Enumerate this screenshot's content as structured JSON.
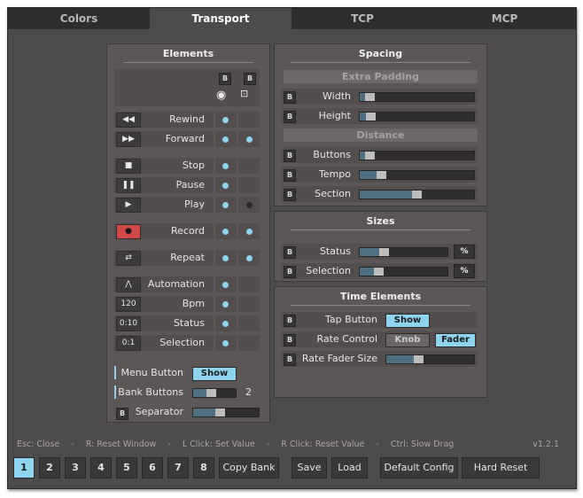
{
  "tabs": [
    {
      "label": "Colors"
    },
    {
      "label": "Transport"
    },
    {
      "label": "TCP"
    },
    {
      "label": "MCP"
    }
  ],
  "elements_panel": {
    "title": "Elements",
    "b_label": "B",
    "items": [
      {
        "icon": "rewind-icon",
        "label": "Rewind",
        "glyph": "◀◀"
      },
      {
        "icon": "forward-icon",
        "label": "Forward",
        "glyph": "▶▶"
      },
      {
        "icon": "stop-icon",
        "label": "Stop",
        "glyph": "■"
      },
      {
        "icon": "pause-icon",
        "label": "Pause",
        "glyph": "❚❚"
      },
      {
        "icon": "play-icon",
        "label": "Play",
        "glyph": "▶"
      },
      {
        "icon": "record-icon",
        "label": "Record",
        "glyph": "●"
      },
      {
        "icon": "repeat-icon",
        "label": "Repeat",
        "glyph": "⇄"
      },
      {
        "icon": "automation-icon",
        "label": "Automation",
        "glyph": "⋀"
      },
      {
        "icon": "bpm-icon",
        "label": "Bpm",
        "glyph": "120"
      },
      {
        "icon": "status-icon",
        "label": "Status",
        "glyph": "0:10"
      },
      {
        "icon": "selection-icon",
        "label": "Selection",
        "glyph": "0:1"
      }
    ],
    "menu_button": {
      "label": "Menu Button",
      "value": "Show"
    },
    "bank_buttons": {
      "label": "Bank Buttons",
      "value": "2",
      "level": 0.4
    },
    "separator": {
      "label": "Separator",
      "level": 0.4
    }
  },
  "spacing_panel": {
    "title": "Spacing",
    "extra_padding": "Extra Padding",
    "distance": "Distance",
    "rows": [
      {
        "label": "Width",
        "level": 0.05
      },
      {
        "label": "Height",
        "level": 0.06
      },
      {
        "label": "Buttons",
        "level": 0.05
      },
      {
        "label": "Tempo",
        "level": 0.16
      },
      {
        "label": "Section",
        "level": 0.5
      }
    ]
  },
  "sizes_panel": {
    "title": "Sizes",
    "pct_label": "%",
    "rows": [
      {
        "label": "Status",
        "level": 0.25
      },
      {
        "label": "Selection",
        "level": 0.18
      }
    ]
  },
  "time_panel": {
    "title": "Time Elements",
    "tap_button": {
      "label": "Tap Button",
      "value": "Show"
    },
    "rate_control": {
      "label": "Rate Control",
      "option_a": "Knob",
      "option_b": "Fader"
    },
    "rate_fader_size": {
      "label": "Rate Fader Size",
      "level": 0.35
    }
  },
  "statusbar": {
    "esc": "Esc: Close",
    "r": "R: Reset Window",
    "lclick": "L Click: Set Value",
    "rclick": "R Click: Reset Value",
    "ctrl": "Ctrl: Slow Drag",
    "sep": "-",
    "version": "v1.2.1"
  },
  "bottom": {
    "banks": [
      "1",
      "2",
      "3",
      "4",
      "5",
      "6",
      "7",
      "8"
    ],
    "selected_bank": "1",
    "copy_bank": "Copy Bank",
    "save": "Save",
    "load": "Load",
    "default_config": "Default Config",
    "hard_reset": "Hard Reset"
  },
  "colors": {
    "accent": "#8fd4ef",
    "record": "#d04848",
    "background": "#4e4b4c"
  }
}
